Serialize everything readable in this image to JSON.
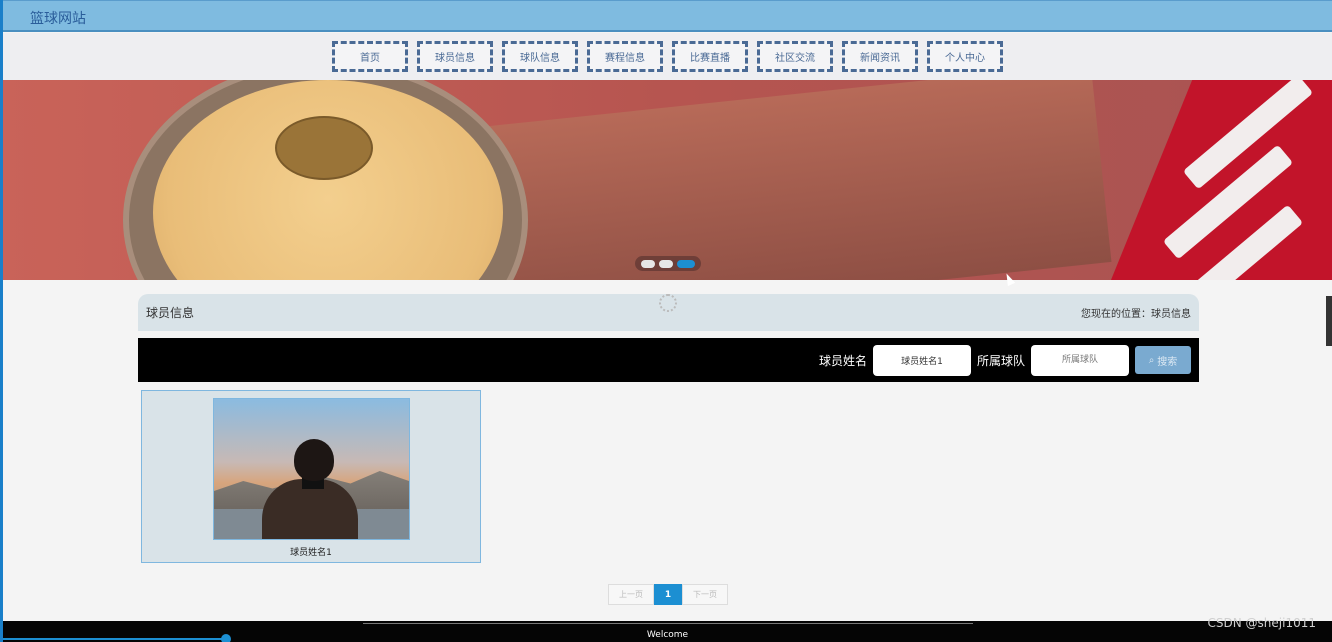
{
  "header": {
    "site_title": "篮球网站"
  },
  "nav": {
    "items": [
      {
        "label": "首页"
      },
      {
        "label": "球员信息"
      },
      {
        "label": "球队信息"
      },
      {
        "label": "赛程信息"
      },
      {
        "label": "比赛直播"
      },
      {
        "label": "社区交流"
      },
      {
        "label": "新闻资讯"
      },
      {
        "label": "个人中心"
      }
    ]
  },
  "banner": {
    "slide_count": 3,
    "active_slide": 3
  },
  "breadcrumb": {
    "title": "球员信息",
    "location_label": "您现在的位置：",
    "location_value": "球员信息"
  },
  "search": {
    "name_label": "球员姓名",
    "name_value": "球员姓名1",
    "team_label": "所属球队",
    "team_placeholder": "所属球队",
    "button_label": "搜索"
  },
  "players": [
    {
      "name": "球员姓名1"
    }
  ],
  "pagination": {
    "prev": "上一页",
    "current": "1",
    "next": "下一页"
  },
  "footer": {
    "text": "Welcome"
  },
  "watermark": "CSDN @sheji1011",
  "colors": {
    "accent": "#1c8fd2",
    "topbar": "#7fbbe0",
    "nav_border": "#4a6a95"
  }
}
